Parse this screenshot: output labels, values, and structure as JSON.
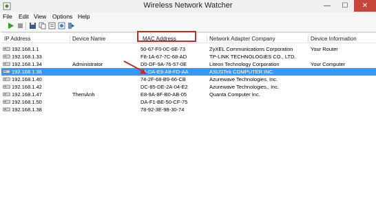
{
  "window": {
    "title": "Wireless Network Watcher",
    "min": "—",
    "max": "☐",
    "close": "✕"
  },
  "menu": [
    "File",
    "Edit",
    "View",
    "Options",
    "Help"
  ],
  "toolbar": {
    "icons": [
      "play-icon",
      "stop-icon",
      "save-icon",
      "copy-icon",
      "properties-icon",
      "html-report-icon",
      "exit-icon"
    ]
  },
  "columns": [
    "IP Address",
    "Device Name",
    "MAC Address",
    "Network Adapter Company",
    "Device Information"
  ],
  "rows": [
    {
      "ip": "192.168.1.1",
      "name": "",
      "mac": "50-67-F0-0C-6E-73",
      "company": "ZyXEL Communications Corporation",
      "info": "Your Router"
    },
    {
      "ip": "192.168.1.33",
      "name": "",
      "mac": "F8-1A-67-7C-68-AD",
      "company": "TP-LINK TECHNOLOGIES CO., LTD.",
      "info": ""
    },
    {
      "ip": "192.168.1.34",
      "name": "Administrator",
      "mac": "D0-DF-9A-76-57-0E",
      "company": "Liteon Technology Corporation",
      "info": "Your Computer"
    },
    {
      "ip": "192.168.1.36",
      "name": "",
      "mac": "14-DA-E9-A8-FD-AA",
      "company": "ASUSTek COMPUTER INC.",
      "info": ""
    },
    {
      "ip": "192.168.1.40",
      "name": "",
      "mac": "74-2F-68-B9-66-CB",
      "company": "Azurewave Technologies, Inc.",
      "info": ""
    },
    {
      "ip": "192.168.1.42",
      "name": "",
      "mac": "DC-85-DE-2A-04-E2",
      "company": "Azurewave Technologies,, Inc.",
      "info": ""
    },
    {
      "ip": "192.168.1.47",
      "name": "ThemAnh",
      "mac": "E8-9A-8F-B0-AB-05",
      "company": "Quanta Computer Inc.",
      "info": ""
    },
    {
      "ip": "192.168.1.50",
      "name": "",
      "mac": "DA-F1-BE-50-CF-75",
      "company": "",
      "info": ""
    },
    {
      "ip": "192.168.1.38",
      "name": "",
      "mac": "78-92-3E-98-30-74",
      "company": "",
      "info": ""
    }
  ],
  "colors": {
    "selection": "#3399ff",
    "annotation": "#c52b2b",
    "close": "#c7463c"
  }
}
